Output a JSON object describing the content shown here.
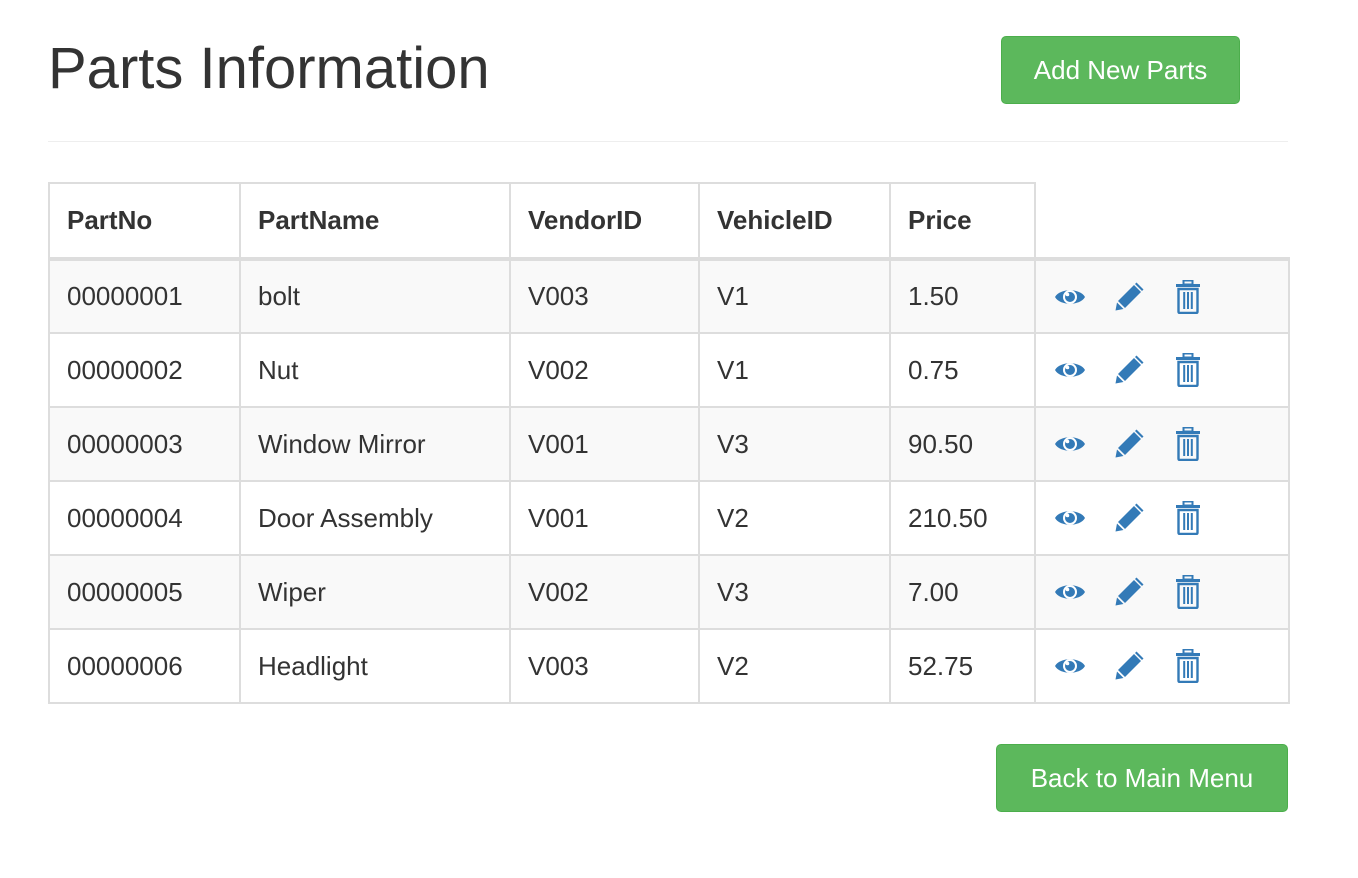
{
  "header": {
    "title": "Parts Information",
    "add_button_label": "Add New Parts"
  },
  "table": {
    "columns": [
      "PartNo",
      "PartName",
      "VendorID",
      "VehicleID",
      "Price"
    ],
    "rows": [
      [
        "00000001",
        "bolt",
        "V003",
        "V1",
        "1.50"
      ],
      [
        "00000002",
        "Nut",
        "V002",
        "V1",
        "0.75"
      ],
      [
        "00000003",
        "Window Mirror",
        "V001",
        "V3",
        "90.50"
      ],
      [
        "00000004",
        "Door Assembly",
        "V001",
        "V2",
        "210.50"
      ],
      [
        "00000005",
        "Wiper",
        "V002",
        "V3",
        "7.00"
      ],
      [
        "00000006",
        "Headlight",
        "V003",
        "V2",
        "52.75"
      ]
    ],
    "row_actions": [
      "eye-icon",
      "pencil-icon",
      "trash-icon"
    ]
  },
  "footer": {
    "back_button_label": "Back to Main Menu"
  },
  "colors": {
    "success": "#5cb85c",
    "icon": "#337ab7",
    "text": "#333333",
    "border": "#dddddd",
    "stripe": "#f9f9f9"
  }
}
